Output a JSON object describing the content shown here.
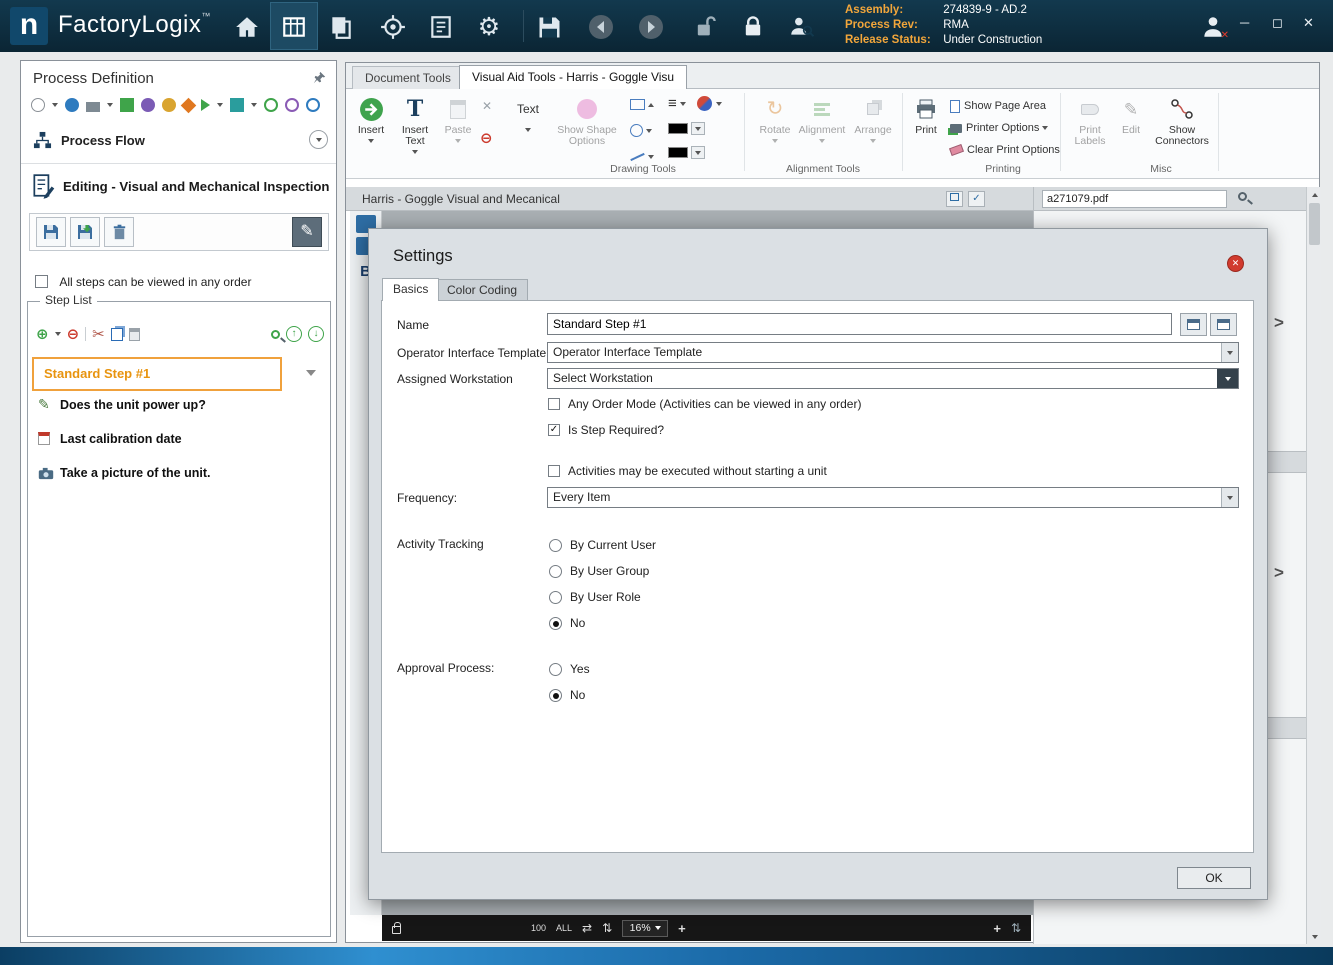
{
  "colors": {
    "titlebar": "#0d2c3d",
    "accent_orange": "#f0a13c",
    "selected_step_text": "#e8940f",
    "close_red": "#d13b2e",
    "insert_green": "#3fa34d"
  },
  "icons": {
    "caret": "▾",
    "chevron_right": ">",
    "close": "✕",
    "minimize": "─",
    "maximize": "◻",
    "plus_circle": "⊕",
    "minus_circle": "⊖",
    "scissors": "✂",
    "check": "✓",
    "pencil": "✎",
    "gear": "⚙",
    "rotate": "↻",
    "list": "≡",
    "text_tool": "T",
    "arrow_up": "↑",
    "arrow_down": "↓",
    "x_mark": "✕",
    "trademark": "™",
    "swap": "⇄",
    "updown": "⇅",
    "plus": "+"
  },
  "titlebar": {
    "app_name": "FactoryLogix",
    "assembly_label": "Assembly:",
    "assembly_value": "274839-9 - AD.2",
    "process_rev_label": "Process Rev:",
    "process_rev_value": "RMA",
    "release_status_label": "Release Status:",
    "release_status_value": "Under Construction"
  },
  "left_panel": {
    "title": "Process Definition",
    "process_flow_label": "Process Flow",
    "editing_label": "Editing - Visual and Mechanical Inspection",
    "any_order_label": "All steps can be viewed in any order",
    "step_list_label": "Step List",
    "steps": [
      {
        "label": "Standard Step #1"
      },
      {
        "label": "Does the unit power up?"
      },
      {
        "label": "Last calibration date"
      },
      {
        "label": "Take a picture of the unit."
      }
    ]
  },
  "ribbon": {
    "tabs": [
      {
        "label": "Document Tools"
      },
      {
        "label": "Visual Aid Tools - Harris - Goggle Visu"
      }
    ],
    "drawing": {
      "insert": "Insert",
      "insert_text": "Insert Text",
      "paste": "Paste",
      "text": "Text",
      "show_shape_options": "Show Shape Options",
      "group_label": "Drawing Tools"
    },
    "alignment": {
      "rotate": "Rotate",
      "alignment": "Alignment",
      "arrange": "Arrange",
      "group_label": "Alignment Tools"
    },
    "printing": {
      "print": "Print",
      "show_page_area": "Show Page Area",
      "printer_options": "Printer Options",
      "clear_print_options": "Clear Print Options",
      "group_label": "Printing"
    },
    "misc": {
      "print_labels": "Print Labels",
      "edit": "Edit",
      "show_connectors": "Show Connectors",
      "group_label": "Misc"
    }
  },
  "document": {
    "title": "Harris - Goggle Visual and Mecanical",
    "attachment_name": "a271079.pdf",
    "left_label": "B",
    "zoom_value": "16%",
    "zoom_100": "100",
    "zoom_all": "ALL"
  },
  "dialog": {
    "title": "Settings",
    "tabs": [
      {
        "label": "Basics"
      },
      {
        "label": "Color Coding"
      }
    ],
    "name_label": "Name",
    "name_value": "Standard Step #1",
    "operator_interface_label": "Operator Interface Template",
    "operator_interface_value": "Operator Interface Template",
    "workstation_label": "Assigned Workstation",
    "workstation_value": "Select Workstation",
    "any_order_label": "Any Order Mode (Activities can be viewed in any order)",
    "step_required_label": "Is Step Required?",
    "activities_label": "Activities may be executed without starting a unit",
    "frequency_label": "Frequency:",
    "frequency_value": "Every Item",
    "activity_tracking_label": "Activity Tracking",
    "activity_options": [
      {
        "label": "By Current User",
        "selected": false
      },
      {
        "label": "By User Group",
        "selected": false
      },
      {
        "label": "By User Role",
        "selected": false
      },
      {
        "label": "No",
        "selected": true
      }
    ],
    "approval_label": "Approval Process:",
    "approval_options": [
      {
        "label": "Yes",
        "selected": false
      },
      {
        "label": "No",
        "selected": true
      }
    ],
    "ok_label": "OK"
  }
}
